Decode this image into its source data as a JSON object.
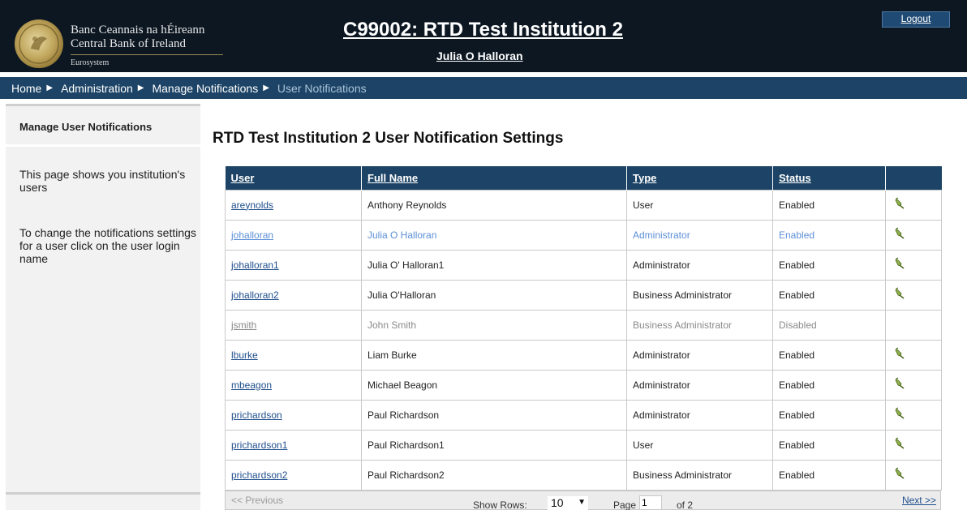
{
  "header": {
    "bank_name_irish": "Banc Ceannais na hÉireann",
    "bank_name_english": "Central Bank of Ireland",
    "eurosystem": "Eurosystem",
    "institution_title": "C99002: RTD Test Institution 2",
    "user_name": "Julia O Halloran",
    "logout_label": "Logout"
  },
  "breadcrumb": {
    "items": [
      "Home",
      "Administration",
      "Manage Notifications",
      "User Notifications"
    ]
  },
  "sidebar": {
    "title": "Manage User Notifications",
    "help_1": "This page shows you institution's users",
    "help_2": "To change the notifications settings for a user click on the user login name"
  },
  "main": {
    "title": "RTD Test Institution 2 User Notification Settings"
  },
  "table": {
    "columns": [
      "User",
      "Full Name",
      "Type",
      "Status"
    ],
    "rows": [
      {
        "user": "areynolds",
        "full_name": "Anthony Reynolds",
        "type": "User",
        "status": "Enabled"
      },
      {
        "user": "johalloran",
        "full_name": "Julia O Halloran",
        "type": "Administrator",
        "status": "Enabled"
      },
      {
        "user": "johalloran1",
        "full_name": "Julia O' Halloran1",
        "type": "Administrator",
        "status": "Enabled"
      },
      {
        "user": "johalloran2",
        "full_name": "Julia O'Halloran",
        "type": "Business Administrator",
        "status": "Enabled"
      },
      {
        "user": "jsmith",
        "full_name": "John Smith",
        "type": "Business Administrator",
        "status": "Disabled"
      },
      {
        "user": "lburke",
        "full_name": "Liam Burke",
        "type": "Administrator",
        "status": "Enabled"
      },
      {
        "user": "mbeagon",
        "full_name": "Michael Beagon",
        "type": "Administrator",
        "status": "Enabled"
      },
      {
        "user": "prichardson",
        "full_name": "Paul Richardson",
        "type": "Administrator",
        "status": "Enabled"
      },
      {
        "user": "prichardson1",
        "full_name": "Paul Richardson1",
        "type": "User",
        "status": "Enabled"
      },
      {
        "user": "prichardson2",
        "full_name": "Paul Richardson2",
        "type": "Business Administrator",
        "status": "Enabled"
      }
    ]
  },
  "pager": {
    "previous_label": "<< Previous",
    "show_rows_label": "Show Rows:",
    "rows_value": "10",
    "page_label": "Page",
    "page_value": "1",
    "page_of": "of 2",
    "next_label": "Next >>"
  },
  "colors": {
    "header_bg": "#0c1722",
    "nav_bg": "#1d4466",
    "link": "#1f4e8c",
    "highlight_row": "#5b8fd6"
  },
  "icons": {
    "logo": "central-bank-seal",
    "edit": "pencil-edit-icon"
  }
}
